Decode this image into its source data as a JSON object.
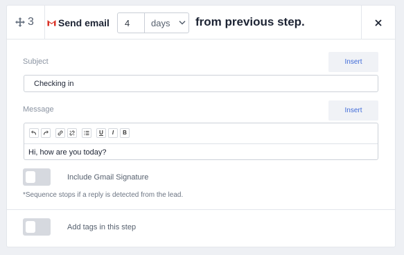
{
  "step": {
    "number": "3",
    "action_label": "Send email",
    "delay_value": "4",
    "delay_unit": "days",
    "from_text": "from previous step."
  },
  "subject": {
    "label": "Subject",
    "value": "Checking in",
    "insert_label": "Insert"
  },
  "message": {
    "label": "Message",
    "insert_label": "Insert",
    "toolbar": [
      "undo",
      "redo",
      "link",
      "unlink",
      "bulleted-list",
      "U",
      "I",
      "B"
    ],
    "body": "Hi, how are you today?"
  },
  "gmail_signature": {
    "label": "Include Gmail Signature",
    "enabled": false
  },
  "note": "*Sequence stops if a reply is detected from the lead.",
  "tags": {
    "label": "Add tags in this step",
    "enabled": false
  },
  "colors": {
    "gmail_red": "#d93025",
    "accent_blue": "#3f6ad8",
    "toggle_off": "#d6d9df"
  }
}
